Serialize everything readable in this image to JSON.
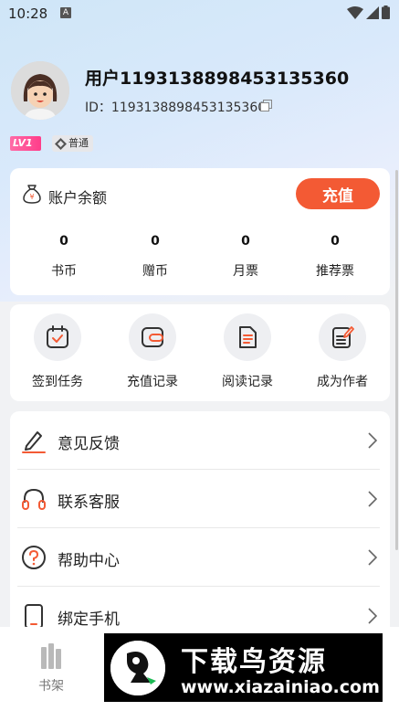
{
  "status_bar": {
    "time": "10:28",
    "notif_letter": "A"
  },
  "profile": {
    "username": "用户1193138898453135360",
    "user_id": "ID：1193138898453135360",
    "level_badge": "LV1",
    "level_name": "普通"
  },
  "balance": {
    "title": "账户余额",
    "recharge_label": "充值",
    "stats": [
      {
        "value": "0",
        "label": "书币"
      },
      {
        "value": "0",
        "label": "赠币"
      },
      {
        "value": "0",
        "label": "月票"
      },
      {
        "value": "0",
        "label": "推荐票"
      }
    ]
  },
  "tools": [
    {
      "label": "签到任务",
      "icon": "calendar-check-icon"
    },
    {
      "label": "充值记录",
      "icon": "wallet-icon"
    },
    {
      "label": "阅读记录",
      "icon": "document-icon"
    },
    {
      "label": "成为作者",
      "icon": "edit-document-icon"
    }
  ],
  "menu": [
    {
      "label": "意见反馈",
      "icon": "pen-icon"
    },
    {
      "label": "联系客服",
      "icon": "headset-icon"
    },
    {
      "label": "帮助中心",
      "icon": "question-icon"
    },
    {
      "label": "绑定手机",
      "icon": "phone-icon"
    }
  ],
  "bottom_nav": {
    "shelf_label": "书架"
  },
  "watermark": {
    "title": "下载鸟资源",
    "url": "www.xiazainiao.com"
  },
  "colors": {
    "accent": "#f35a34",
    "lv_badge": "#ff3d8a"
  }
}
